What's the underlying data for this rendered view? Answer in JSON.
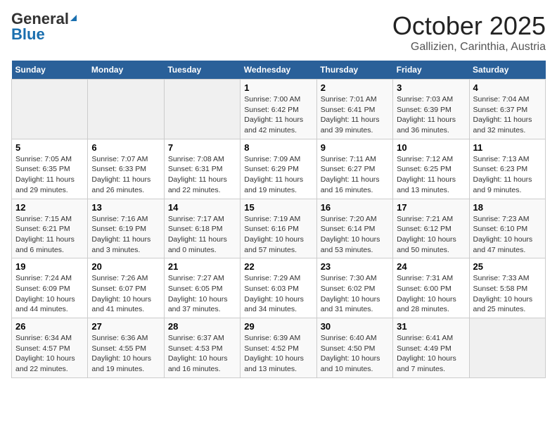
{
  "header": {
    "logo_general": "General",
    "logo_blue": "Blue",
    "title": "October 2025",
    "subtitle": "Gallizien, Carinthia, Austria"
  },
  "weekdays": [
    "Sunday",
    "Monday",
    "Tuesday",
    "Wednesday",
    "Thursday",
    "Friday",
    "Saturday"
  ],
  "weeks": [
    [
      {
        "day": "",
        "info": ""
      },
      {
        "day": "",
        "info": ""
      },
      {
        "day": "",
        "info": ""
      },
      {
        "day": "1",
        "info": "Sunrise: 7:00 AM\nSunset: 6:42 PM\nDaylight: 11 hours and 42 minutes."
      },
      {
        "day": "2",
        "info": "Sunrise: 7:01 AM\nSunset: 6:41 PM\nDaylight: 11 hours and 39 minutes."
      },
      {
        "day": "3",
        "info": "Sunrise: 7:03 AM\nSunset: 6:39 PM\nDaylight: 11 hours and 36 minutes."
      },
      {
        "day": "4",
        "info": "Sunrise: 7:04 AM\nSunset: 6:37 PM\nDaylight: 11 hours and 32 minutes."
      }
    ],
    [
      {
        "day": "5",
        "info": "Sunrise: 7:05 AM\nSunset: 6:35 PM\nDaylight: 11 hours and 29 minutes."
      },
      {
        "day": "6",
        "info": "Sunrise: 7:07 AM\nSunset: 6:33 PM\nDaylight: 11 hours and 26 minutes."
      },
      {
        "day": "7",
        "info": "Sunrise: 7:08 AM\nSunset: 6:31 PM\nDaylight: 11 hours and 22 minutes."
      },
      {
        "day": "8",
        "info": "Sunrise: 7:09 AM\nSunset: 6:29 PM\nDaylight: 11 hours and 19 minutes."
      },
      {
        "day": "9",
        "info": "Sunrise: 7:11 AM\nSunset: 6:27 PM\nDaylight: 11 hours and 16 minutes."
      },
      {
        "day": "10",
        "info": "Sunrise: 7:12 AM\nSunset: 6:25 PM\nDaylight: 11 hours and 13 minutes."
      },
      {
        "day": "11",
        "info": "Sunrise: 7:13 AM\nSunset: 6:23 PM\nDaylight: 11 hours and 9 minutes."
      }
    ],
    [
      {
        "day": "12",
        "info": "Sunrise: 7:15 AM\nSunset: 6:21 PM\nDaylight: 11 hours and 6 minutes."
      },
      {
        "day": "13",
        "info": "Sunrise: 7:16 AM\nSunset: 6:19 PM\nDaylight: 11 hours and 3 minutes."
      },
      {
        "day": "14",
        "info": "Sunrise: 7:17 AM\nSunset: 6:18 PM\nDaylight: 11 hours and 0 minutes."
      },
      {
        "day": "15",
        "info": "Sunrise: 7:19 AM\nSunset: 6:16 PM\nDaylight: 10 hours and 57 minutes."
      },
      {
        "day": "16",
        "info": "Sunrise: 7:20 AM\nSunset: 6:14 PM\nDaylight: 10 hours and 53 minutes."
      },
      {
        "day": "17",
        "info": "Sunrise: 7:21 AM\nSunset: 6:12 PM\nDaylight: 10 hours and 50 minutes."
      },
      {
        "day": "18",
        "info": "Sunrise: 7:23 AM\nSunset: 6:10 PM\nDaylight: 10 hours and 47 minutes."
      }
    ],
    [
      {
        "day": "19",
        "info": "Sunrise: 7:24 AM\nSunset: 6:09 PM\nDaylight: 10 hours and 44 minutes."
      },
      {
        "day": "20",
        "info": "Sunrise: 7:26 AM\nSunset: 6:07 PM\nDaylight: 10 hours and 41 minutes."
      },
      {
        "day": "21",
        "info": "Sunrise: 7:27 AM\nSunset: 6:05 PM\nDaylight: 10 hours and 37 minutes."
      },
      {
        "day": "22",
        "info": "Sunrise: 7:29 AM\nSunset: 6:03 PM\nDaylight: 10 hours and 34 minutes."
      },
      {
        "day": "23",
        "info": "Sunrise: 7:30 AM\nSunset: 6:02 PM\nDaylight: 10 hours and 31 minutes."
      },
      {
        "day": "24",
        "info": "Sunrise: 7:31 AM\nSunset: 6:00 PM\nDaylight: 10 hours and 28 minutes."
      },
      {
        "day": "25",
        "info": "Sunrise: 7:33 AM\nSunset: 5:58 PM\nDaylight: 10 hours and 25 minutes."
      }
    ],
    [
      {
        "day": "26",
        "info": "Sunrise: 6:34 AM\nSunset: 4:57 PM\nDaylight: 10 hours and 22 minutes."
      },
      {
        "day": "27",
        "info": "Sunrise: 6:36 AM\nSunset: 4:55 PM\nDaylight: 10 hours and 19 minutes."
      },
      {
        "day": "28",
        "info": "Sunrise: 6:37 AM\nSunset: 4:53 PM\nDaylight: 10 hours and 16 minutes."
      },
      {
        "day": "29",
        "info": "Sunrise: 6:39 AM\nSunset: 4:52 PM\nDaylight: 10 hours and 13 minutes."
      },
      {
        "day": "30",
        "info": "Sunrise: 6:40 AM\nSunset: 4:50 PM\nDaylight: 10 hours and 10 minutes."
      },
      {
        "day": "31",
        "info": "Sunrise: 6:41 AM\nSunset: 4:49 PM\nDaylight: 10 hours and 7 minutes."
      },
      {
        "day": "",
        "info": ""
      }
    ]
  ]
}
